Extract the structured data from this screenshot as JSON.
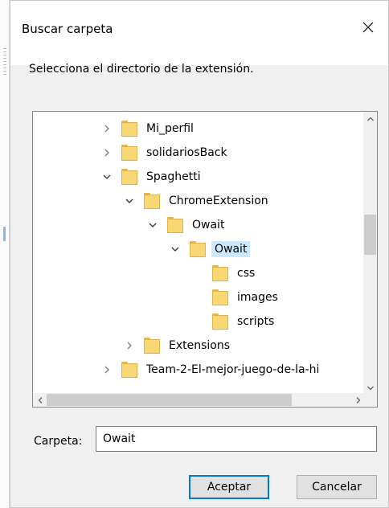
{
  "dialog": {
    "title": "Buscar carpeta",
    "instruction": "Selecciona el directorio de la extensión."
  },
  "tree": {
    "items": [
      {
        "label": "Mi_perfil",
        "level": 1,
        "expander": "collapsed"
      },
      {
        "label": "solidariosBack",
        "level": 1,
        "expander": "collapsed"
      },
      {
        "label": "Spaghetti",
        "level": 1,
        "expander": "expanded"
      },
      {
        "label": "ChromeExtension",
        "level": 2,
        "expander": "expanded"
      },
      {
        "label": "Owait",
        "level": 3,
        "expander": "expanded"
      },
      {
        "label": "Owait",
        "level": 4,
        "expander": "expanded",
        "selected": true
      },
      {
        "label": "css",
        "level": 5,
        "expander": "none"
      },
      {
        "label": "images",
        "level": 5,
        "expander": "none"
      },
      {
        "label": "scripts",
        "level": 5,
        "expander": "none"
      },
      {
        "label": "Extensions",
        "level": 2,
        "expander": "collapsed"
      },
      {
        "label": "Team-2-El-mejor-juego-de-la-hi",
        "level": 1,
        "expander": "collapsed"
      }
    ]
  },
  "folder_field": {
    "label": "Carpeta:",
    "value": "Owait"
  },
  "buttons": {
    "accept": "Aceptar",
    "cancel": "Cancelar"
  },
  "colors": {
    "selection": "#cce8ff",
    "default_button_border": "#0078d7",
    "folder": "#f8d775"
  }
}
